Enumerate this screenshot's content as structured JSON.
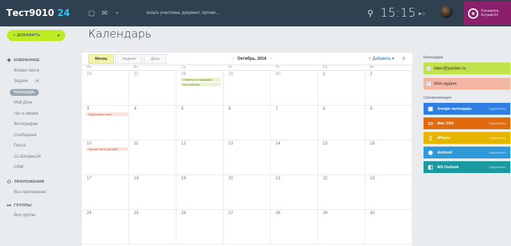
{
  "topbar": {
    "logo_name": "Тест9010",
    "logo_num": "24",
    "search_placeholder": "искать участника, документ, прочее...",
    "time": "15:15",
    "user_text": "Расширить Битрикс24"
  },
  "sidebar": {
    "add_button": "+ ДОБАВИТЬ",
    "favorites_header": "ИЗБРАННОЕ",
    "items": [
      {
        "label": "Живая лента"
      },
      {
        "label": "Задачи",
        "count": "4"
      },
      {
        "label": "Календарь",
        "active": true
      },
      {
        "label": "Мой Диск"
      },
      {
        "label": "Чат и звонки"
      },
      {
        "label": "Фотографии"
      },
      {
        "label": "Сообщения"
      },
      {
        "label": "Почта"
      },
      {
        "label": "1С-Битрикс24"
      },
      {
        "label": "CRM"
      }
    ],
    "apps_header": "ПРИЛОЖЕНИЯ",
    "apps_items": [
      {
        "label": "Все приложения"
      }
    ],
    "groups_header": "ГРУППЫ",
    "groups_items": [
      {
        "label": "Все группы"
      }
    ]
  },
  "page": {
    "title": "Календарь"
  },
  "calendar": {
    "tabs": [
      "Месяц",
      "Неделя",
      "День"
    ],
    "active_tab": "Месяц",
    "month_label": "Октябрь, 2016",
    "add_label": "Добавить",
    "weekdays": [
      "Пн",
      "Вт",
      "Ср",
      "Чт",
      "Пт",
      "Сб",
      "Вс"
    ],
    "weeks": [
      [
        "26",
        "27",
        "28",
        "29",
        "30",
        "1",
        "2"
      ],
      [
        "3",
        "4",
        "5",
        "6",
        "7",
        "8",
        "9"
      ],
      [
        "10",
        "11",
        "12",
        "13",
        "14",
        "15",
        "16"
      ],
      [
        "17",
        "18",
        "19",
        "20",
        "21",
        "22",
        "23"
      ],
      [
        "24",
        "25",
        "26",
        "27",
        "28",
        "29",
        "30"
      ]
    ],
    "events": {
      "ev1": "Семинар по продажам",
      "ev2": "Моя событие",
      "ev3": "Подготовить отчет",
      "ev4": "Сделать фото деталей"
    }
  },
  "right_panel": {
    "calendars_header": "Календари",
    "calendars": [
      {
        "label": "labor@yandex.ru",
        "color": "#c2e24c"
      },
      {
        "label": "Мои задачи",
        "color": "#f3b7a4"
      }
    ],
    "sync_header": "Синхронизация",
    "sync": [
      {
        "label": "Google календарь",
        "color": "#2f7fe2",
        "icon": "calendar-icon"
      },
      {
        "label": "Mac OSX",
        "color": "#e06a0d",
        "icon": "monitor-icon"
      },
      {
        "label": "iPhone",
        "color": "#e5b500",
        "icon": "phone-icon"
      },
      {
        "label": "Android",
        "color": "#2e9ad9",
        "icon": "android-icon"
      },
      {
        "label": "MS Outlook",
        "color": "#1a9aa0",
        "icon": "outlook-icon"
      }
    ],
    "connect_label": "подключить"
  }
}
